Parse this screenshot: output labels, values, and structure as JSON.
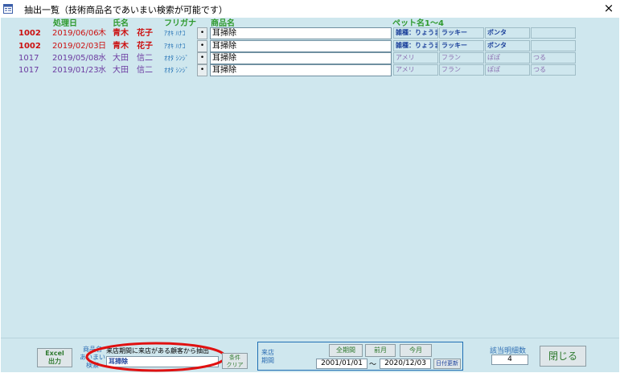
{
  "window": {
    "title": "抽出一覧（技術商品名であいまい検索が可能です）",
    "close_glyph": "×"
  },
  "columns": {
    "date": "処理日",
    "name": "氏名",
    "kana": "フリガナ",
    "product": "商品名",
    "pets": "ペット名1〜4"
  },
  "rows": [
    {
      "id": "1002",
      "date": "2019/06/06",
      "day": "木",
      "name": "青木　花子",
      "kana": "ｱｵｷ ﾊﾅｺ",
      "dot": "•",
      "product": "耳掃除",
      "pets": [
        "雑種：りょうま",
        "ラッキー",
        "ポンタ",
        ""
      ],
      "color": "#cc1111",
      "bold": true
    },
    {
      "id": "1002",
      "date": "2019/02/03",
      "day": "日",
      "name": "青木　花子",
      "kana": "ｱｵｷ ﾊﾅｺ",
      "dot": "•",
      "product": "耳掃除",
      "pets": [
        "雑種：りょうま",
        "ラッキー",
        "ポンタ",
        ""
      ],
      "color": "#cc1111",
      "bold": true
    },
    {
      "id": "1017",
      "date": "2019/05/08",
      "day": "水",
      "name": "大田　信二",
      "kana": "ｵｵﾀ ｼﾝｼﾞ",
      "dot": "•",
      "product": "耳掃除",
      "pets": [
        "アメリ",
        "フラン",
        "ぽぽ",
        "つる"
      ],
      "color": "#6b3aa0",
      "bold": false
    },
    {
      "id": "1017",
      "date": "2019/01/23",
      "day": "水",
      "name": "大田　信二",
      "kana": "ｵｵﾀ ｼﾝｼﾞ",
      "dot": "•",
      "product": "耳掃除",
      "pets": [
        "アメリ",
        "フラン",
        "ぽぽ",
        "つる"
      ],
      "color": "#6b3aa0",
      "bold": false
    }
  ],
  "footer": {
    "excel_label_1": "Excel",
    "excel_label_2": "出力",
    "search_label_1": "商品名",
    "search_label_2": "あいまい",
    "search_label_3": "検索",
    "search_note": "来店期間に来店がある顧客から抽出",
    "search_value": "耳掃除",
    "clear_label_1": "条件",
    "clear_label_2": "クリア",
    "period_label_1": "来店",
    "period_label_2": "期間",
    "all_period": "全期間",
    "prev_month": "前月",
    "this_month": "今月",
    "date_from": "2001/01/01",
    "tilde": "〜",
    "date_to": "2020/12/03",
    "date_update": "日付更新",
    "count_label": "該当明細数",
    "count_value": "4",
    "close_label": "閉じる"
  },
  "colors": {
    "background": "#cfe7ee",
    "header_green": "#2f9a2f",
    "highlight_circle": "#e01010"
  }
}
